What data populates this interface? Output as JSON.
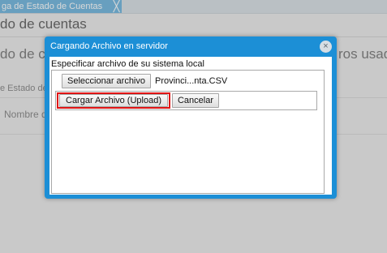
{
  "background": {
    "tab_label": "ga de Estado de Cuentas",
    "tab_close": "╳",
    "title": "do de cuentas",
    "heading_left": "do de cu",
    "heading_right": "ros usad",
    "breadcrumb": "e Estado de",
    "column_name": "Nombre d"
  },
  "dialog": {
    "title": "Cargando Archivo en servidor",
    "close_symbol": "×",
    "spec_label": "Especificar archivo de su sistema local",
    "select_button": "Seleccionar archivo",
    "file_name": "Provinci...nta.CSV",
    "upload_button": "Cargar Archivo (Upload)",
    "cancel_button": "Cancelar"
  },
  "colors": {
    "dialog_blue": "#1c8fd6",
    "highlight_red": "#e01414",
    "tab_blue": "#4aa3d6"
  }
}
